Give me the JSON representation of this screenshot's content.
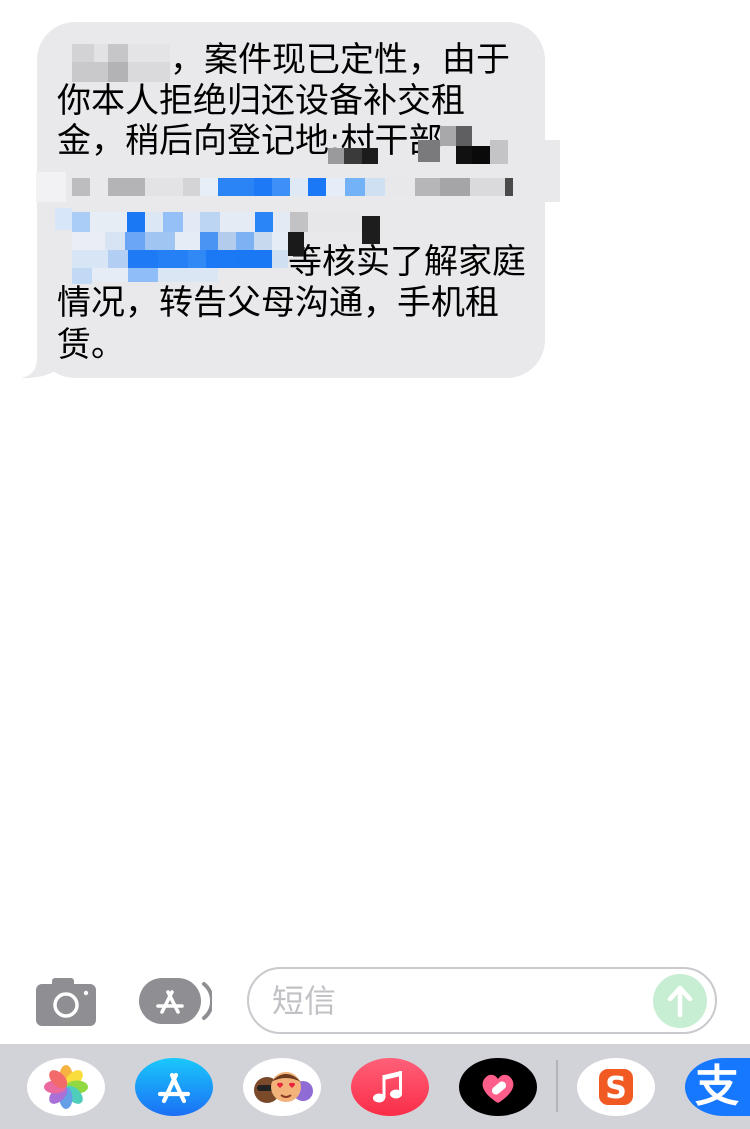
{
  "thread": {
    "bubble": {
      "lines": [
        "，案件现已定性，由于",
        "你本人拒绝归还设备补交租",
        "金，稍后向登记地:村干部",
        "等核实了解家庭",
        "情况，转告父母沟通，手机租",
        "赁。"
      ]
    }
  },
  "composer": {
    "camera_icon": "camera-icon",
    "apps_icon": "app-store-icon",
    "placeholder": "短信",
    "send_icon": "arrow-up-icon"
  },
  "dock": {
    "apps": [
      {
        "icon": "photos-icon"
      },
      {
        "icon": "app-store-icon"
      },
      {
        "icon": "memoji-icon"
      },
      {
        "icon": "music-icon"
      },
      {
        "icon": "heart-bandage-icon"
      },
      {
        "icon": "sogou-icon",
        "glyph": "S"
      },
      {
        "icon": "alipay-icon",
        "glyph": "支"
      }
    ]
  },
  "colors": {
    "bubble": "#e9e9eb",
    "send": "#c7eed2",
    "dock": "#d1d3d8",
    "icon_gray": "#8e8e93"
  }
}
